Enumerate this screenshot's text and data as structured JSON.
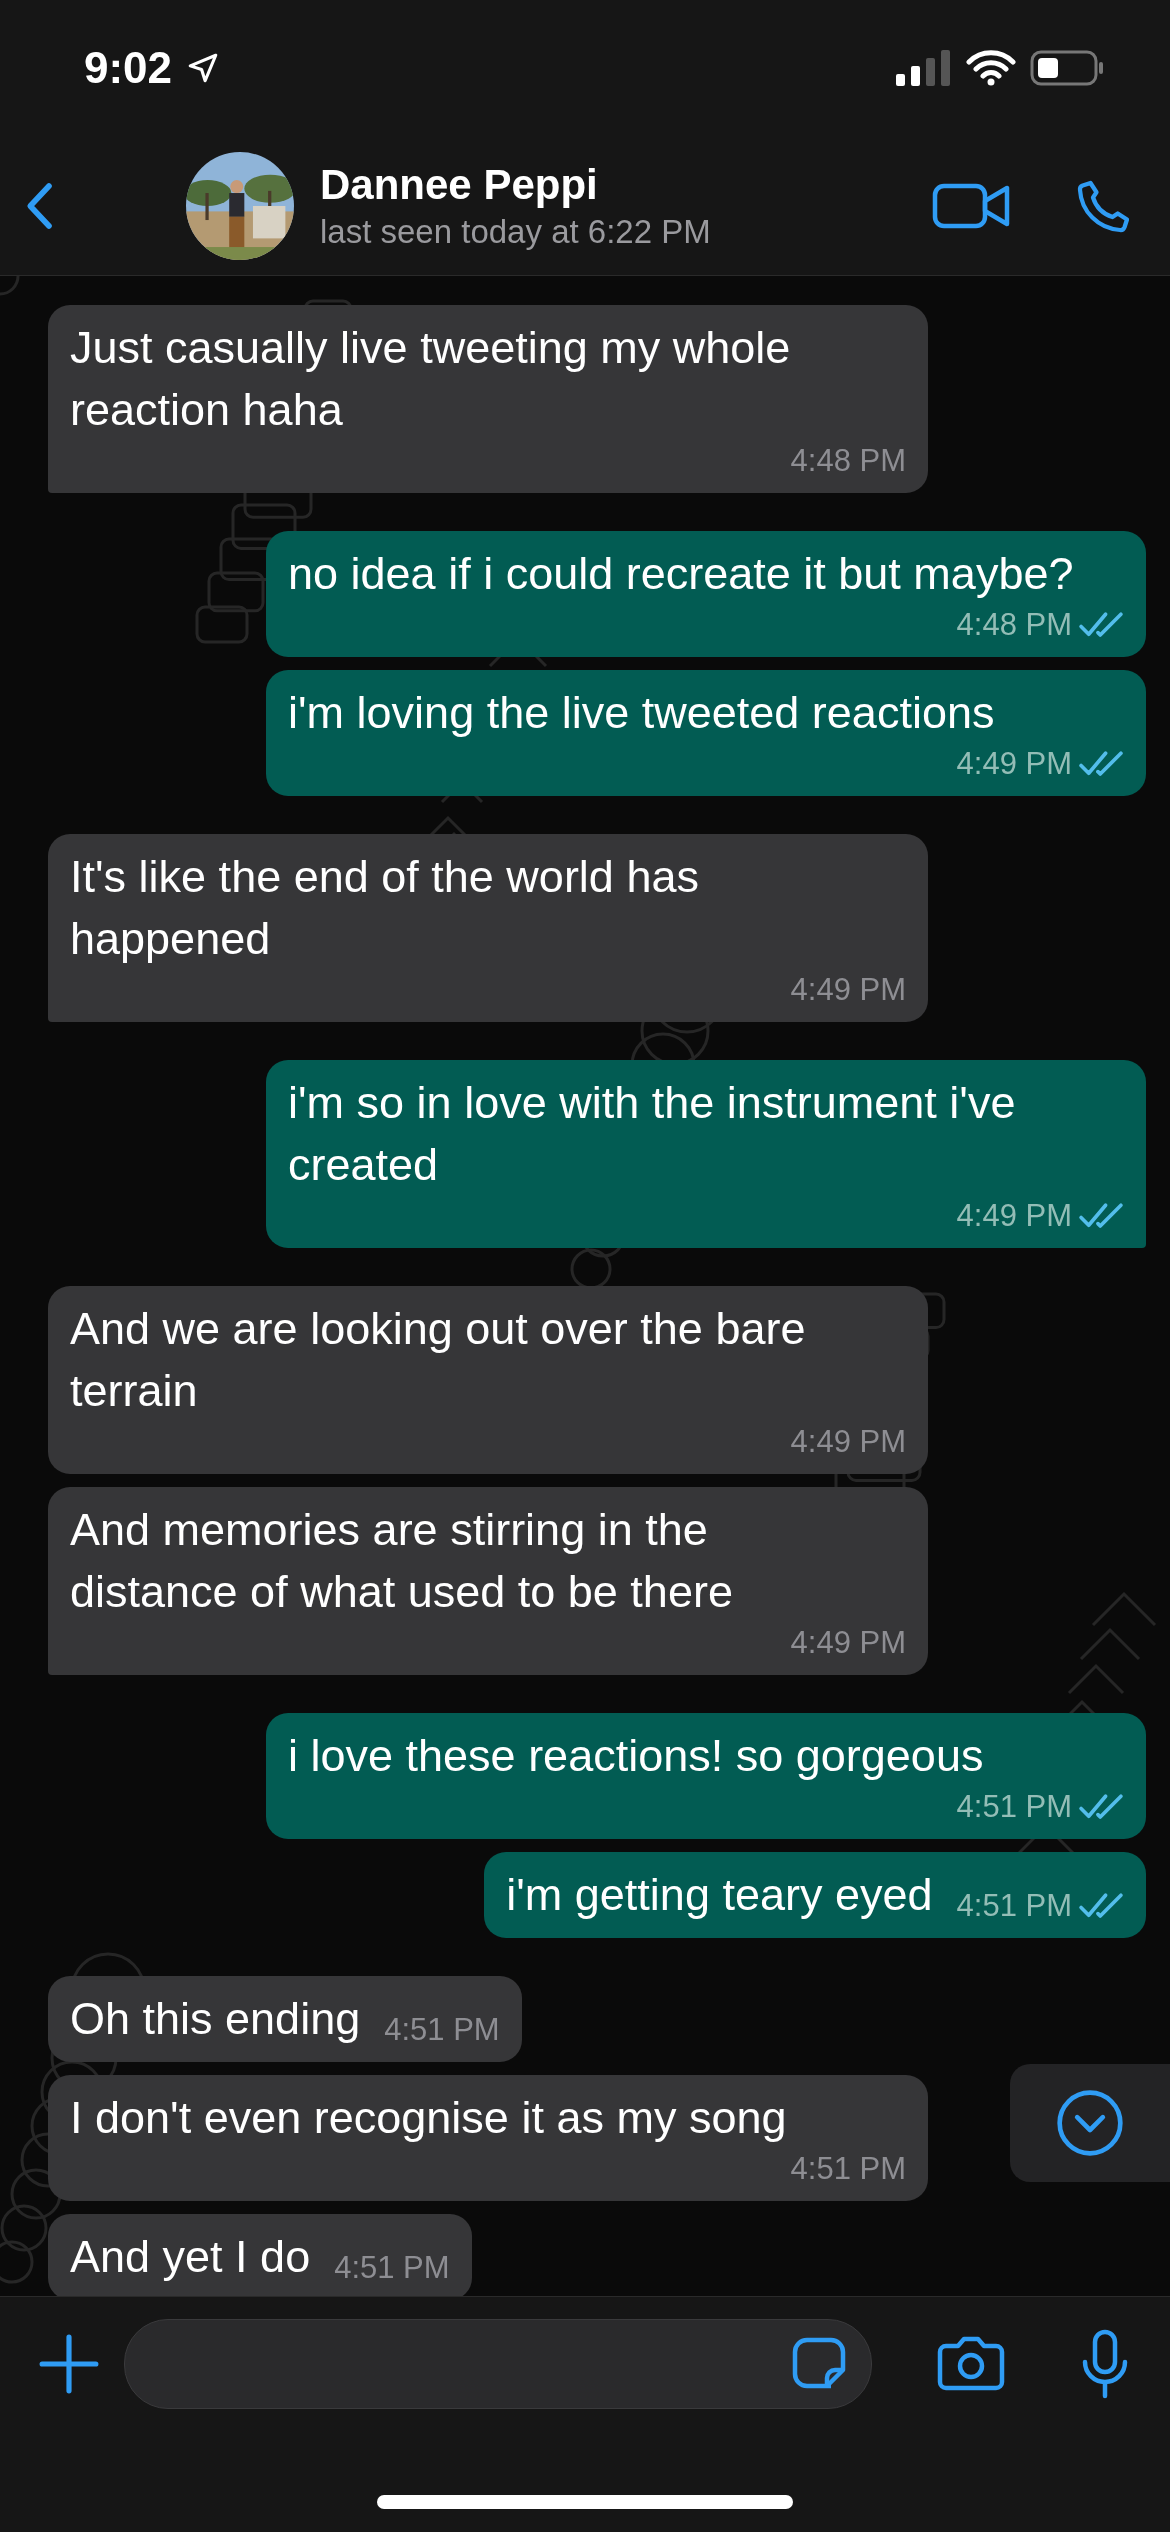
{
  "status_bar": {
    "time": "9:02"
  },
  "header": {
    "name": "Dannee Peppi",
    "last_seen": "last seen today at 6:22 PM"
  },
  "messages": [
    {
      "kind": "in",
      "text": "Just casually live tweeting my whole reaction haha",
      "time": "4:48 PM",
      "tail": true
    },
    {
      "kind": "out",
      "text": "no idea if i could recreate it but maybe?",
      "time": "4:48 PM",
      "read": true,
      "tail": false
    },
    {
      "kind": "out",
      "text": "i'm loving the live tweeted reactions",
      "time": "4:49 PM",
      "read": true,
      "tail": false
    },
    {
      "kind": "in",
      "text": "It's like the end of the world has happened",
      "time": "4:49 PM",
      "tail": true
    },
    {
      "kind": "out",
      "text": "i'm so in love with the instrument i've created",
      "time": "4:49 PM",
      "read": true,
      "tail": true
    },
    {
      "kind": "in",
      "text": "And we are looking out over the bare terrain",
      "time": "4:49 PM",
      "tail": false
    },
    {
      "kind": "in",
      "text": "And memories are stirring in the distance of what used to be there",
      "time": "4:49 PM",
      "tail": true
    },
    {
      "kind": "out",
      "text": "i love these reactions! so gorgeous",
      "time": "4:51 PM",
      "read": true,
      "tail": false
    },
    {
      "kind": "out",
      "text": "i'm getting teary eyed",
      "time": "4:51 PM",
      "read": true,
      "tail": false
    },
    {
      "kind": "in",
      "text": "Oh this ending",
      "time": "4:51 PM",
      "tail": false
    },
    {
      "kind": "in",
      "text": "I don't even recognise it as my song",
      "time": "4:51 PM",
      "tail": false
    },
    {
      "kind": "in",
      "text": "And yet I do",
      "time": "4:51 PM",
      "tail": false
    }
  ]
}
